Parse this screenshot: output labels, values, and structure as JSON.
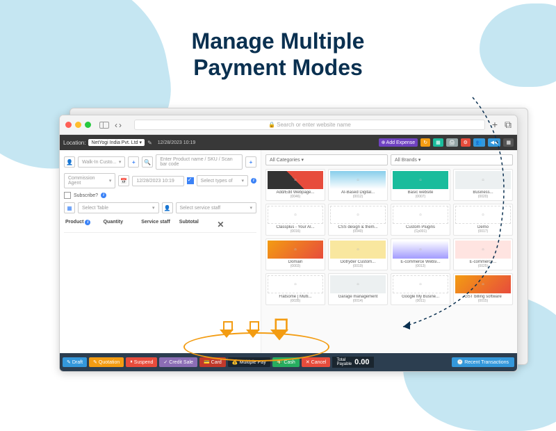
{
  "headline": "Manage Multiple\nPayment Modes",
  "browser": {
    "url_placeholder": "Search or enter website name",
    "back": "‹",
    "forward": "›",
    "plus": "+",
    "copy": "⧉"
  },
  "toolbar": {
    "location_label": "Location:",
    "location_value": "NetYogi India Pvt. Ltd",
    "datetime": "12/28/2023 10:19",
    "add_expense": "Add Expense",
    "buttons_colors": [
      "#f39c12",
      "#1abc9c",
      "#95a5a6",
      "#3498db",
      "#e74c3c",
      "#3498db",
      "#3498db",
      "#555"
    ]
  },
  "left": {
    "customer_value": "Walk-In Custo...",
    "product_placeholder": "Enter Product name / SKU / Scan bar code",
    "commission_placeholder": "Commission Agent",
    "date_value": "12/28/2023 10:19",
    "types_placeholder": "Select types of",
    "subscribe_label": "Subscribe?",
    "table_placeholder": "Select Table",
    "staff_placeholder": "Select service staff",
    "cols": {
      "product": "Product",
      "quantity": "Quantity",
      "service": "Service staff",
      "subtotal": "Subtotal"
    }
  },
  "right": {
    "filter_categories": "All Categories",
    "filter_brands": "All Brands",
    "products": [
      {
        "name": "Add/Edit Webpage...",
        "code": "(0046)",
        "t": "c1"
      },
      {
        "name": "AI-Based Digital...",
        "code": "(0012)",
        "t": "c2"
      },
      {
        "name": "Basic website",
        "code": "(0007)",
        "t": "c3"
      },
      {
        "name": "Business...",
        "code": "(0020)",
        "t": "c4"
      },
      {
        "name": "Classplus - Your AI...",
        "code": "(0016)",
        "t": "c5"
      },
      {
        "name": "CSS design & them...",
        "code": "(0040)",
        "t": "c5"
      },
      {
        "name": "Custom Plugins",
        "code": "(Cp001)",
        "t": "c5"
      },
      {
        "name": "Demo",
        "code": "(0017)",
        "t": "c5"
      },
      {
        "name": "Domain",
        "code": "(0003)",
        "t": "c6"
      },
      {
        "name": "Dotryder Custom...",
        "code": "(0019)",
        "t": "c7"
      },
      {
        "name": "E-commerce Websi...",
        "code": "(0013)",
        "t": "c8"
      },
      {
        "name": "E-commerce...",
        "code": "(0025)",
        "t": "c9"
      },
      {
        "name": "Flatsome | Multi...",
        "code": "(0035)",
        "t": "c5"
      },
      {
        "name": "Garage management",
        "code": "(0014)",
        "t": "c4"
      },
      {
        "name": "Google My Busine...",
        "code": "(0011)",
        "t": "c5"
      },
      {
        "name": "GST billing software",
        "code": "(0015)",
        "t": "c6"
      }
    ]
  },
  "bottom": {
    "draft": "Draft",
    "quotation": "Quotation",
    "suspend": "Suspend",
    "credit": "Credit Sale",
    "card": "Card",
    "multiple": "Multiple Pay",
    "cash": "Cash",
    "cancel": "Cancel",
    "total_label": "Total\nPayable",
    "total_value": "0.00",
    "recent": "Recent Transactions"
  }
}
